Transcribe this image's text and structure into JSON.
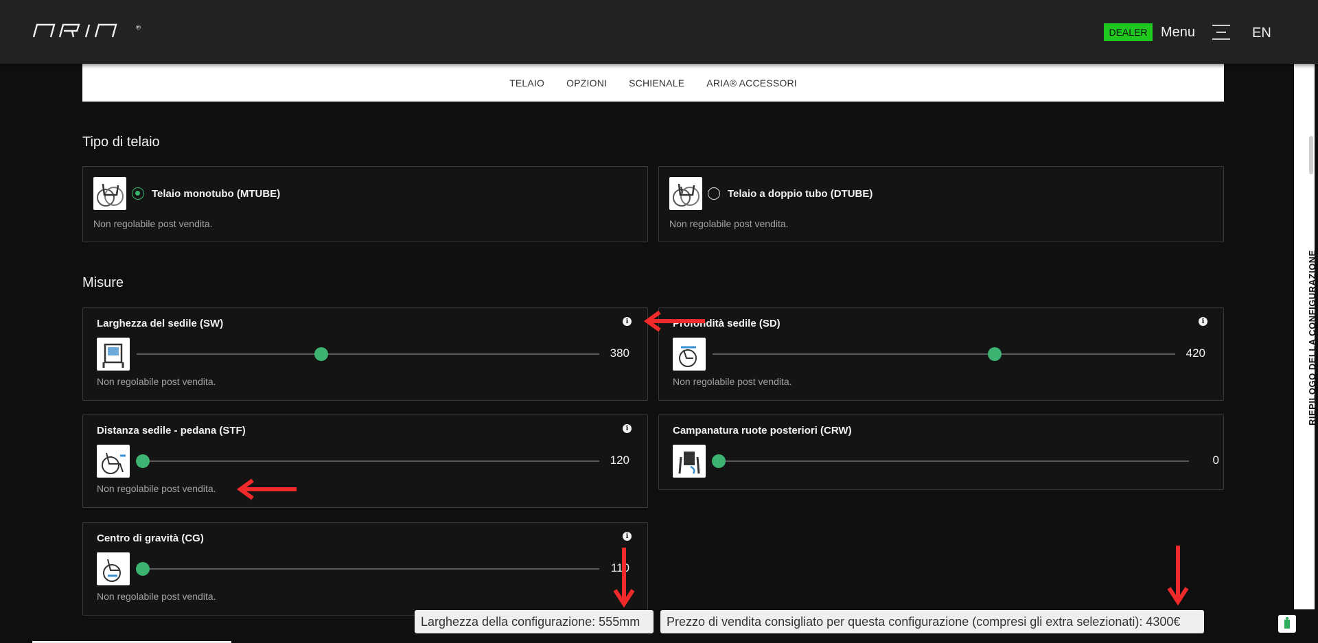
{
  "header": {
    "logo_text": "ARIA",
    "dealer_badge": "DEALER",
    "menu_label": "Menu",
    "language": "EN"
  },
  "tabs": [
    {
      "label": "TELAIO"
    },
    {
      "label": "OPZIONI"
    },
    {
      "label": "SCHIENALE"
    },
    {
      "label": "ARIA® ACCESSORI"
    }
  ],
  "frame_section": {
    "title": "Tipo di telaio",
    "options": [
      {
        "label": "Telaio monotubo (MTUBE)",
        "note": "Non regolabile post vendita.",
        "selected": true
      },
      {
        "label": "Telaio a doppio tubo (DTUBE)",
        "note": "Non regolabile post vendita.",
        "selected": false
      }
    ]
  },
  "measures_section": {
    "title": "Misure",
    "items": [
      {
        "title": "Larghezza del sedile (SW)",
        "value": "380",
        "note": "Non regolabile post vendita.",
        "has_info": true
      },
      {
        "title": "Profondità sedile (SD)",
        "value": "420",
        "note": "Non regolabile post vendita.",
        "has_info": true
      },
      {
        "title": "Distanza sedile - pedana (STF)",
        "value": "120",
        "note": "Non regolabile post vendita.",
        "has_info": true
      },
      {
        "title": "Campanatura ruote posteriori (CRW)",
        "value": "0",
        "note": "",
        "has_info": false
      },
      {
        "title": "Centro di gravità (CG)",
        "value": "110",
        "note": "Non regolabile post vendita.",
        "has_info": true
      }
    ]
  },
  "sidebar": {
    "summary_label": "RIEPILOGO DELLA CONFIGURAZIONE"
  },
  "footer": {
    "width_text": "Larghezza della configurazione: 555mm",
    "price_text": "Prezzo di vendita consigliato per questa configurazione (compresi gli extra selezionati): 4300€"
  },
  "colors": {
    "accent_green": "#3cb371",
    "dealer_green": "#1ec81e",
    "annotation_red": "#f02a2a",
    "background": "#0f0f10"
  }
}
